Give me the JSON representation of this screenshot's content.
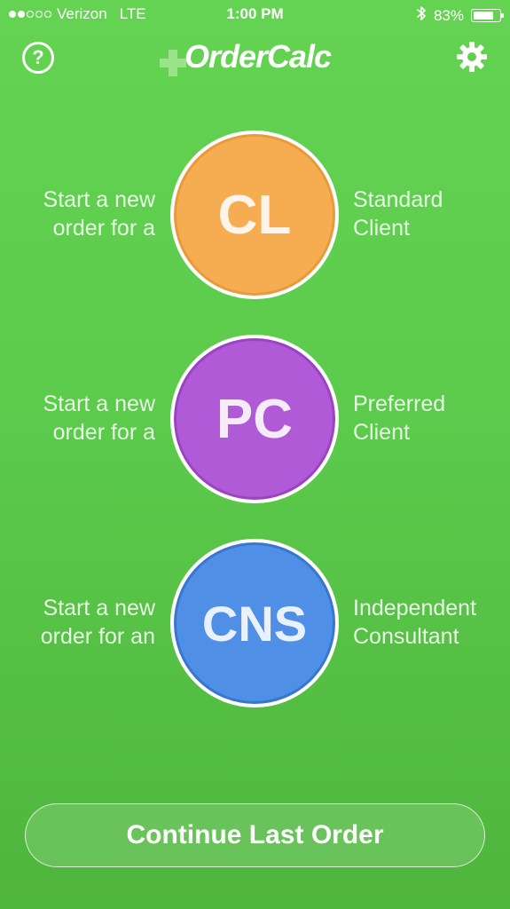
{
  "status_bar": {
    "carrier": "Verizon",
    "network": "LTE",
    "signal_bars_filled": 2,
    "signal_bars_total": 5,
    "time": "1:00 PM",
    "battery_percent_text": "83%",
    "battery_level": 0.83
  },
  "nav": {
    "help_label": "?",
    "logo_text": "OrderCalc",
    "settings_icon": "gear-icon"
  },
  "orders": [
    {
      "prefix_line1": "Start a new",
      "prefix_line2": "order for a",
      "label": "CL",
      "suffix_line1": "Standard",
      "suffix_line2": "Client",
      "color": "#f6ad52"
    },
    {
      "prefix_line1": "Start a new",
      "prefix_line2": "order for a",
      "label": "PC",
      "suffix_line1": "Preferred",
      "suffix_line2": "Client",
      "color": "#b15ad8"
    },
    {
      "prefix_line1": "Start a new",
      "prefix_line2": "order for an",
      "label": "CNS",
      "suffix_line1": "Independent",
      "suffix_line2": "Consultant",
      "color": "#4f8fe6"
    }
  ],
  "continue_button": {
    "label": "Continue Last Order"
  },
  "colors": {
    "background": "#5ccb4c",
    "text": "#ffffff"
  }
}
